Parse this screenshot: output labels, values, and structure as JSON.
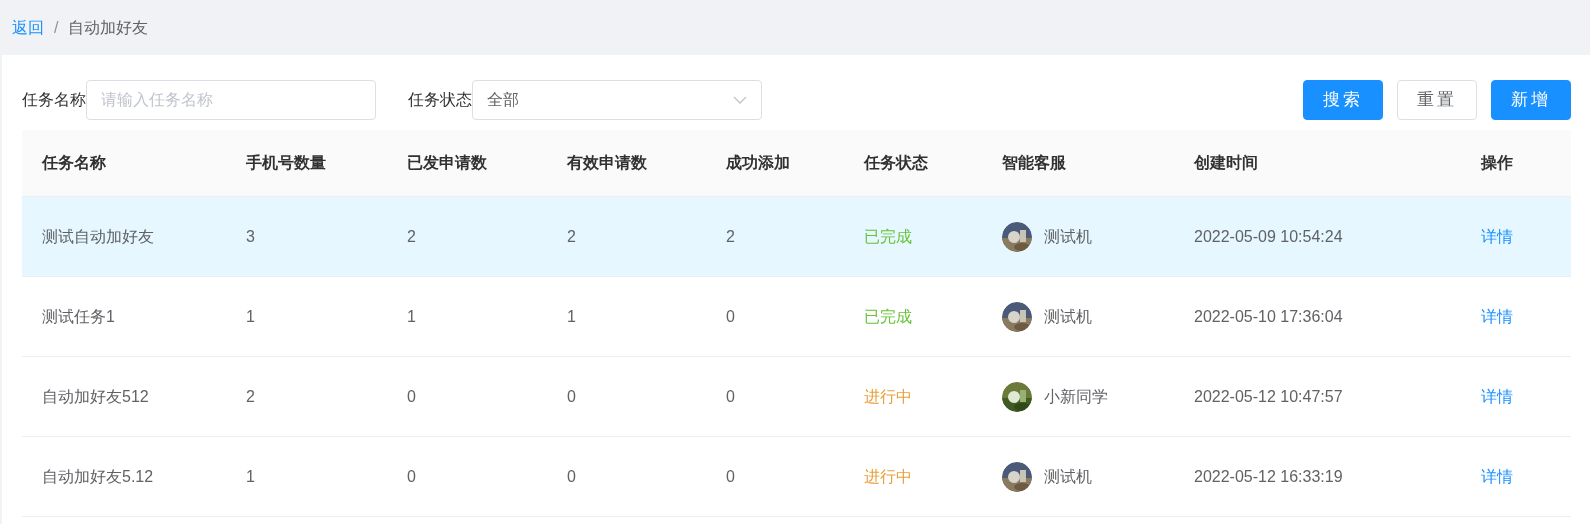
{
  "breadcrumb": [
    {
      "label": "返回",
      "link": true
    },
    {
      "label": "自动加好友",
      "link": false
    }
  ],
  "breadcrumb_separator": "/",
  "filters": [
    {
      "label": "任务名称",
      "kind": "input",
      "placeholder": "请输入任务名称"
    },
    {
      "label": "任务状态",
      "kind": "select",
      "value": "全部"
    }
  ],
  "buttons": [
    {
      "label": "搜索",
      "kind": "primary"
    },
    {
      "label": "重置",
      "kind": "default"
    },
    {
      "label": "新增",
      "kind": "primary"
    }
  ],
  "table": {
    "columns": [
      "任务名称",
      "手机号数量",
      "已发申请数",
      "有效申请数",
      "成功添加",
      "任务状态",
      "智能客服",
      "创建时间",
      "操作"
    ],
    "rows": [
      {
        "selected": true,
        "name": "测试自动加好友",
        "phones": "3",
        "sent": "2",
        "valid": "2",
        "added": "2",
        "status": {
          "text": "已完成",
          "kind": "done"
        },
        "agent": "测试机",
        "created": "2022-05-09 10:54:24",
        "action": "详情"
      },
      {
        "selected": false,
        "name": "测试任务1",
        "phones": "1",
        "sent": "1",
        "valid": "1",
        "added": "0",
        "status": {
          "text": "已完成",
          "kind": "done"
        },
        "agent": "测试机",
        "created": "2022-05-10 17:36:04",
        "action": "详情"
      },
      {
        "selected": false,
        "name": "自动加好友512",
        "phones": "2",
        "sent": "0",
        "valid": "0",
        "added": "0",
        "status": {
          "text": "进行中",
          "kind": "running"
        },
        "agent": "小新同学",
        "created": "2022-05-12 10:47:57",
        "action": "详情"
      },
      {
        "selected": false,
        "name": "自动加好友5.12",
        "phones": "1",
        "sent": "0",
        "valid": "0",
        "added": "0",
        "status": {
          "text": "进行中",
          "kind": "running"
        },
        "agent": "测试机",
        "created": "2022-05-12 16:33:19",
        "action": "详情"
      }
    ]
  }
}
